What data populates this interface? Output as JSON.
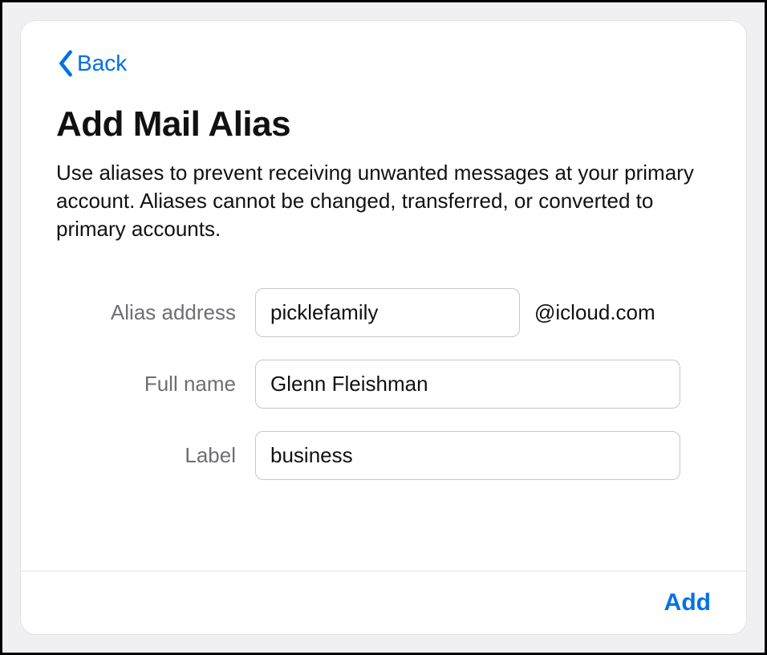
{
  "nav": {
    "back_label": "Back"
  },
  "header": {
    "title": "Add Mail Alias",
    "description": "Use aliases to prevent receiving unwanted messages at your primary account. Aliases cannot be changed, transferred, or converted to primary accounts."
  },
  "form": {
    "alias": {
      "label": "Alias address",
      "value": "picklefamily",
      "domain": "@icloud.com"
    },
    "fullname": {
      "label": "Full name",
      "value": "Glenn Fleishman"
    },
    "label_field": {
      "label": "Label",
      "value": "business"
    }
  },
  "footer": {
    "add_label": "Add"
  },
  "colors": {
    "accent": "#0071e3",
    "border": "#c7c7cc",
    "muted": "#6e6e73"
  }
}
